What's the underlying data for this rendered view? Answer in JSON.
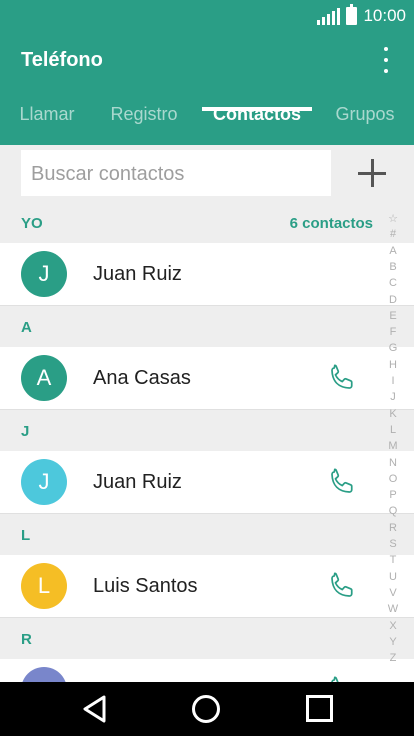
{
  "status": {
    "time": "10:00",
    "signal_icon": "signal-icon",
    "battery_icon": "battery-icon"
  },
  "app": {
    "title": "Teléfono",
    "overflow_icon": "more-vertical-icon",
    "accent_color": "#2a9e86"
  },
  "tabs": [
    {
      "label": "Llamar",
      "active": false
    },
    {
      "label": "Registro",
      "active": false
    },
    {
      "label": "Contactos",
      "active": true
    },
    {
      "label": "Grupos",
      "active": false
    }
  ],
  "search": {
    "placeholder": "Buscar contactos",
    "add_icon": "plus-icon"
  },
  "sections": [
    {
      "letter": "YO",
      "count": "6 contactos"
    },
    {
      "letter": "A"
    },
    {
      "letter": "J"
    },
    {
      "letter": "L"
    },
    {
      "letter": "R"
    }
  ],
  "contacts": [
    {
      "initial": "J",
      "name": "Juan Ruiz",
      "color": "#2a9e86",
      "call": false
    },
    {
      "initial": "A",
      "name": "Ana Casas",
      "color": "#2a9e86",
      "call": true
    },
    {
      "initial": "J",
      "name": "Juan Ruiz",
      "color": "#4dc8dc",
      "call": true
    },
    {
      "initial": "L",
      "name": "Luis Santos",
      "color": "#f5be25",
      "call": true
    },
    {
      "initial": "",
      "name": "",
      "color": "#7986cb",
      "call": true
    }
  ],
  "index": [
    "☆",
    "#",
    "A",
    "B",
    "C",
    "D",
    "E",
    "F",
    "G",
    "H",
    "I",
    "J",
    "K",
    "L",
    "M",
    "N",
    "O",
    "P",
    "Q",
    "R",
    "S",
    "T",
    "U",
    "V",
    "W",
    "X",
    "Y",
    "Z"
  ],
  "nav": {
    "back_icon": "back-icon",
    "home_icon": "home-icon",
    "recent_icon": "recent-apps-icon"
  }
}
